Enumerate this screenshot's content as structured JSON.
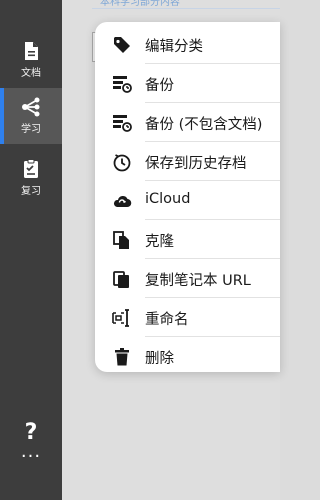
{
  "sidebar": {
    "items": [
      {
        "label": "文档",
        "icon": "document-icon"
      },
      {
        "label": "学习",
        "icon": "share-tree-icon",
        "active": true
      },
      {
        "label": "复习",
        "icon": "clipboard-check-icon"
      }
    ],
    "help_label": "?",
    "more_label": "···"
  },
  "header": {
    "title": "本科学习部分内容",
    "more_label": "···"
  },
  "menu": {
    "items": [
      {
        "label": "编辑分类",
        "icon": "tag-icon"
      },
      {
        "label": "备份",
        "icon": "backup-icon"
      },
      {
        "label": "备份 (不包含文档)",
        "icon": "backup-no-docs-icon"
      },
      {
        "label": "保存到历史存档",
        "icon": "history-clock-icon"
      },
      {
        "label": "iCloud",
        "icon": "icloud-icon"
      },
      {
        "label": "克隆",
        "icon": "clone-icon"
      },
      {
        "label": "复制笔记本 URL",
        "icon": "copy-url-icon"
      },
      {
        "label": "重命名",
        "icon": "rename-icon"
      },
      {
        "label": "删除",
        "icon": "trash-icon"
      }
    ]
  },
  "colors": {
    "sidebar_bg": "#3d3d3d",
    "active_bg": "#575757",
    "accent": "#2f80ed",
    "menu_bg": "#ffffff"
  }
}
